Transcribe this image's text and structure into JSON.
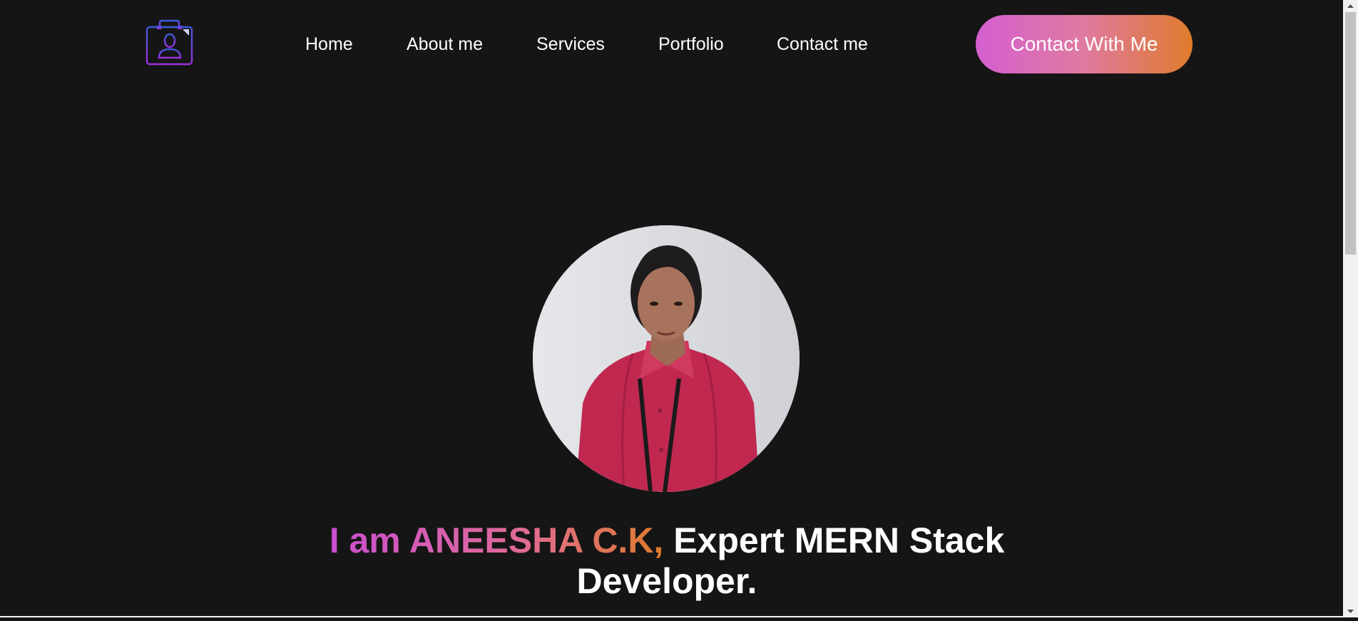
{
  "header": {
    "logo_icon": "briefcase-person-icon",
    "nav": [
      {
        "label": "Home"
      },
      {
        "label": "About me"
      },
      {
        "label": "Services"
      },
      {
        "label": "Portfolio"
      },
      {
        "label": "Contact me"
      }
    ],
    "cta_label": "Contact With Me"
  },
  "hero": {
    "photo": "profile-photo",
    "headline_gradient": "I am ANEESHA C.K,",
    "headline_rest": " Expert MERN Stack Developer."
  },
  "colors": {
    "background": "#161515",
    "gradient_start": "#d45fd0",
    "gradient_end": "#df7b2b",
    "logo_stroke_start": "#3b5bdb",
    "logo_stroke_end": "#9b30e0"
  }
}
